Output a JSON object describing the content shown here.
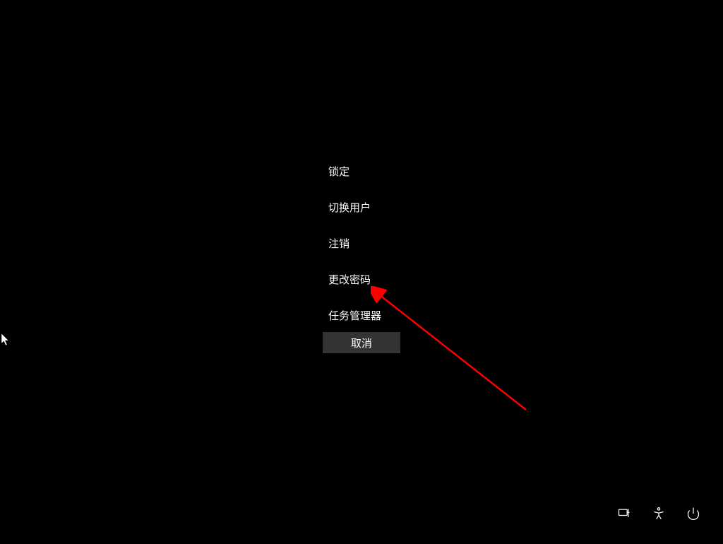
{
  "menu": {
    "items": [
      {
        "label": "锁定"
      },
      {
        "label": "切换用户"
      },
      {
        "label": "注销"
      },
      {
        "label": "更改密码"
      },
      {
        "label": "任务管理器"
      }
    ],
    "cancel_label": "取消"
  },
  "bottom_icons": {
    "network": "network-icon",
    "accessibility": "accessibility-icon",
    "power": "power-icon"
  }
}
